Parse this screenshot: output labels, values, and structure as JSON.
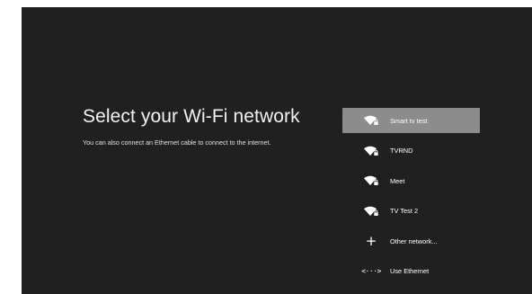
{
  "page": {
    "title": "Select your Wi-Fi network",
    "subtitle": "You can also connect an Ethernet cable to connect to the internet."
  },
  "networks": [
    {
      "label": "Smart tv test",
      "icon": "wifi-locked-icon",
      "selected": true
    },
    {
      "label": "TVRND",
      "icon": "wifi-locked-icon",
      "selected": false
    },
    {
      "label": "Meet",
      "icon": "wifi-locked-icon",
      "selected": false
    },
    {
      "label": "TV Test 2",
      "icon": "wifi-locked-icon",
      "selected": false
    }
  ],
  "actions": {
    "other_network": {
      "label": "Other network...",
      "icon": "plus-icon"
    },
    "use_ethernet": {
      "label": "Use Ethernet",
      "icon": "ethernet-icon"
    }
  },
  "colors": {
    "background": "#202020",
    "selected": "#8c8c8c",
    "text": "#ffffff"
  }
}
